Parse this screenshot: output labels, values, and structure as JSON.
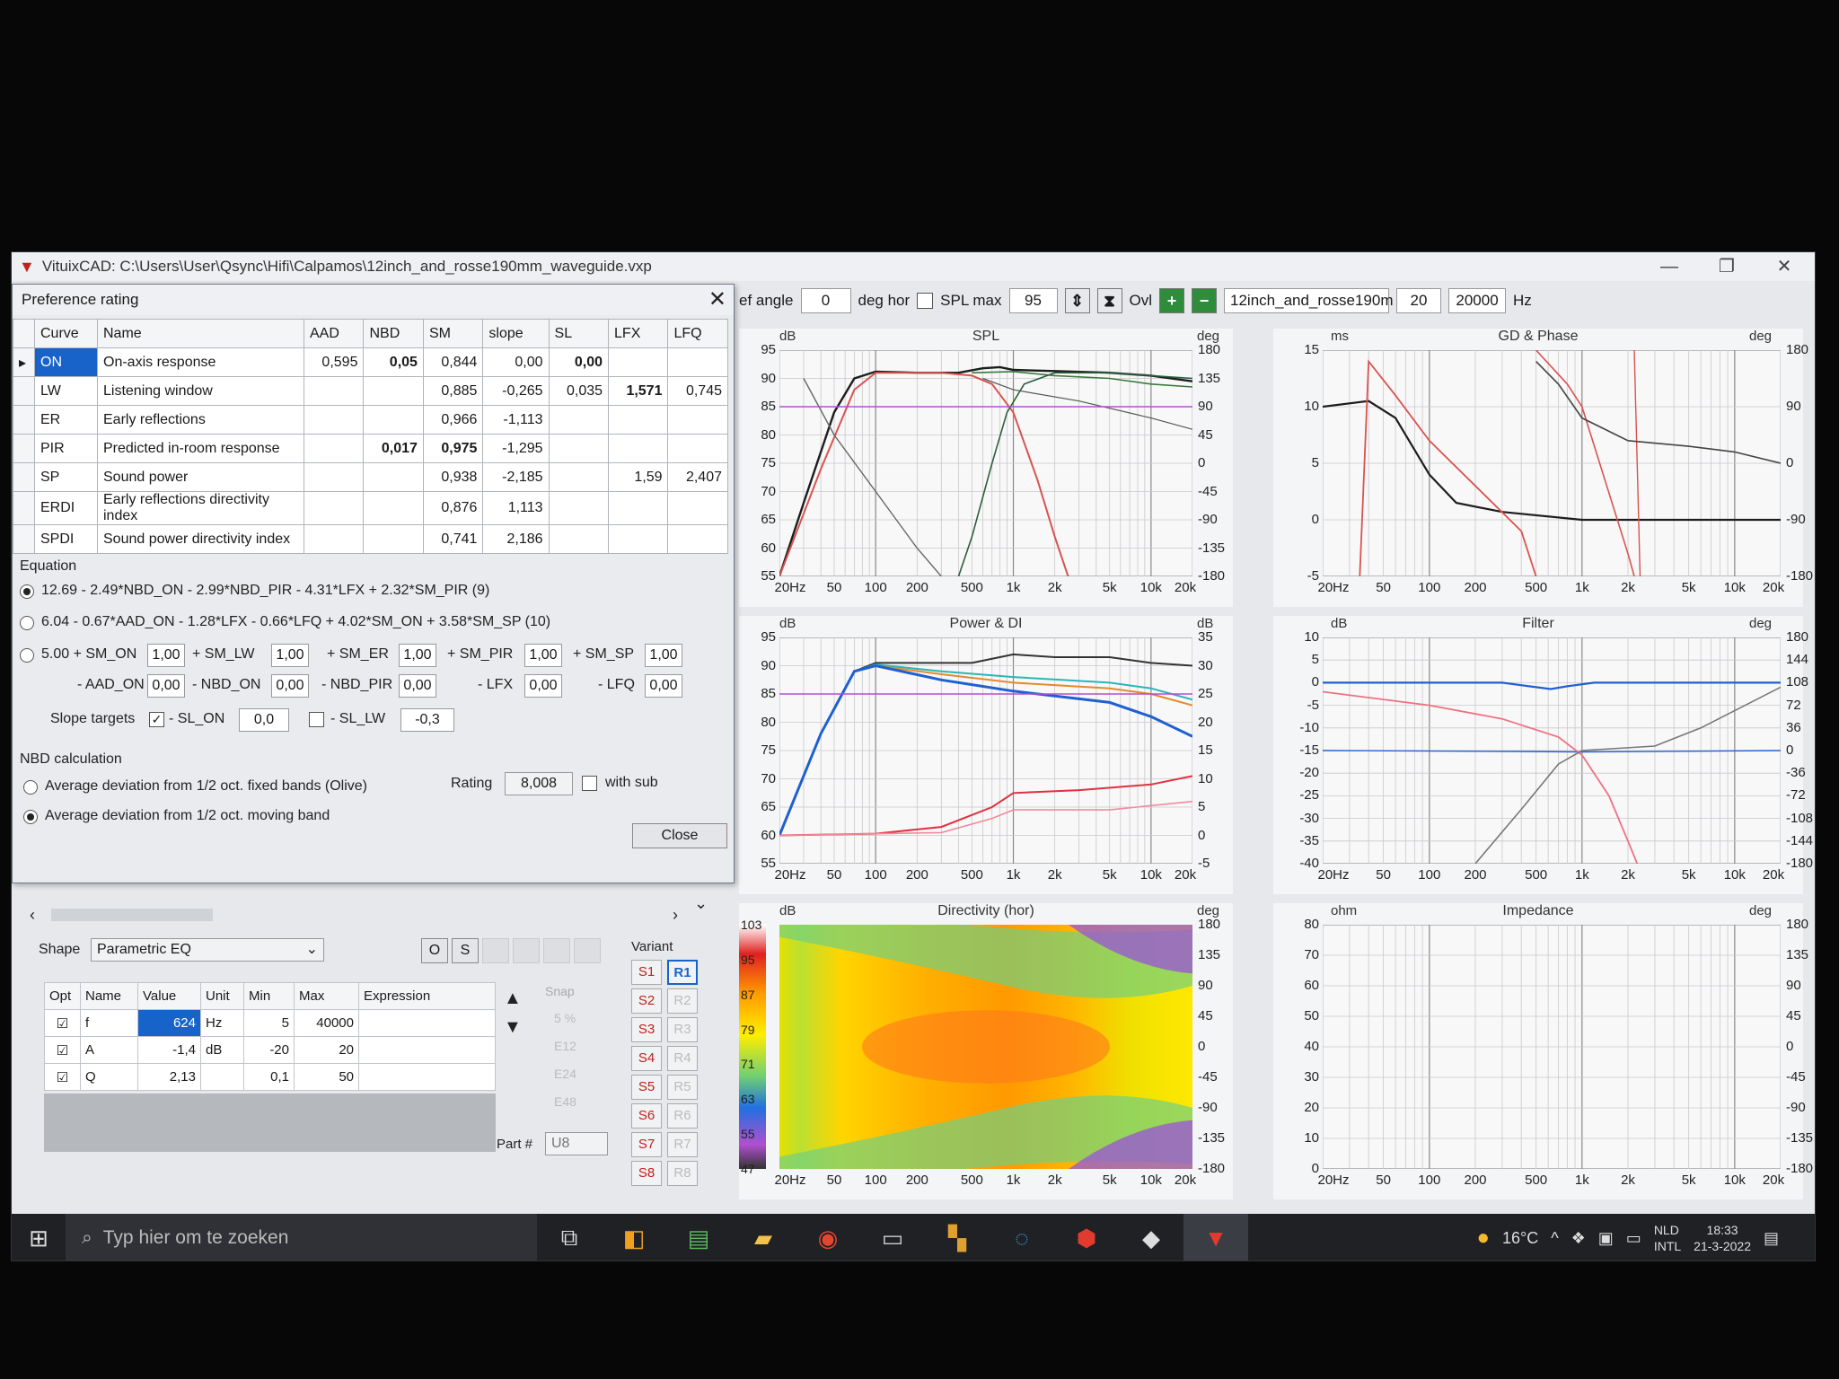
{
  "window": {
    "title": "VituixCAD: C:\\Users\\User\\Qsync\\Hifi\\Calpamos\\12inch_and_rosse190mm_waveguide.vxp"
  },
  "toolbar": {
    "ref_angle_label": "ef angle",
    "ref_angle_value": "0",
    "deg_hor": "deg hor",
    "spl_max_label": "SPL max",
    "spl_max_value": "95",
    "ovl_label": "Ovl",
    "project": "12inch_and_rosse190m",
    "fmin": "20",
    "fmax": "20000",
    "hz": "Hz"
  },
  "dialog": {
    "title": "Preference rating",
    "columns": [
      "Curve",
      "Name",
      "AAD",
      "NBD",
      "SM",
      "slope",
      "SL",
      "LFX",
      "LFQ"
    ],
    "rows": [
      {
        "curve": "ON",
        "name": "On-axis response",
        "aad": "0,595",
        "nbd": "0,05",
        "sm": "0,844",
        "slope": "0,00",
        "sl": "0,00",
        "lfx": "",
        "lfq": ""
      },
      {
        "curve": "LW",
        "name": "Listening window",
        "aad": "",
        "nbd": "",
        "sm": "0,885",
        "slope": "-0,265",
        "sl": "0,035",
        "lfx": "1,571",
        "lfq": "0,745"
      },
      {
        "curve": "ER",
        "name": "Early reflections",
        "aad": "",
        "nbd": "",
        "sm": "0,966",
        "slope": "-1,113",
        "sl": "",
        "lfx": "",
        "lfq": ""
      },
      {
        "curve": "PIR",
        "name": "Predicted in-room response",
        "aad": "",
        "nbd": "0,017",
        "sm": "0,975",
        "slope": "-1,295",
        "sl": "",
        "lfx": "",
        "lfq": ""
      },
      {
        "curve": "SP",
        "name": "Sound power",
        "aad": "",
        "nbd": "",
        "sm": "0,938",
        "slope": "-2,185",
        "sl": "",
        "lfx": "1,59",
        "lfq": "2,407"
      },
      {
        "curve": "ERDI",
        "name": "Early reflections directivity index",
        "aad": "",
        "nbd": "",
        "sm": "0,876",
        "slope": "1,113",
        "sl": "",
        "lfx": "",
        "lfq": ""
      },
      {
        "curve": "SPDI",
        "name": "Sound power directivity index",
        "aad": "",
        "nbd": "",
        "sm": "0,741",
        "slope": "2,186",
        "sl": "",
        "lfx": "",
        "lfq": ""
      }
    ],
    "equation_label": "Equation",
    "eq1": "12.69 - 2.49*NBD_ON - 2.99*NBD_PIR - 4.31*LFX + 2.32*SM_PIR (9)",
    "eq2": "6.04 - 0.67*AAD_ON - 1.28*LFX - 0.66*LFQ + 4.02*SM_ON + 3.58*SM_SP (10)",
    "eq3": {
      "prefix": "5.00 + SM_ON",
      "sm_on": "1,00",
      "sm_lw_lbl": "+ SM_LW",
      "sm_lw": "1,00",
      "sm_er_lbl": "+ SM_ER",
      "sm_er": "1,00",
      "sm_pir_lbl": "+ SM_PIR",
      "sm_pir": "1,00",
      "sm_sp_lbl": "+ SM_SP",
      "sm_sp": "1,00",
      "aad_on_lbl": "- AAD_ON",
      "aad_on": "0,00",
      "nbd_on_lbl": "- NBD_ON",
      "nbd_on": "0,00",
      "nbd_pir_lbl": "- NBD_PIR",
      "nbd_pir": "0,00",
      "lfx_lbl": "- LFX",
      "lfx": "0,00",
      "lfq_lbl": "- LFQ",
      "lfq": "0,00"
    },
    "slope_targets": "Slope targets",
    "sl_on_lbl": "- SL_ON",
    "sl_on": "0,0",
    "sl_lw_lbl": "- SL_LW",
    "sl_lw": "-0,3",
    "nbd_calc": "NBD calculation",
    "nbd_opt1": "Average deviation from 1/2 oct. fixed bands (Olive)",
    "nbd_opt2": "Average deviation from 1/2 oct. moving band",
    "rating_label": "Rating",
    "rating_value": "8,008",
    "with_sub": "with sub",
    "close": "Close"
  },
  "eq_panel": {
    "shape_label": "Shape",
    "shape_value": "Parametric EQ",
    "btn_o": "O",
    "btn_s": "S",
    "columns": [
      "Opt",
      "Name",
      "Value",
      "Unit",
      "Min",
      "Max",
      "Expression"
    ],
    "rows": [
      {
        "name": "f",
        "value": "624",
        "unit": "Hz",
        "min": "5",
        "max": "40000"
      },
      {
        "name": "A",
        "value": "-1,4",
        "unit": "dB",
        "min": "-20",
        "max": "20"
      },
      {
        "name": "Q",
        "value": "2,13",
        "unit": "",
        "min": "0,1",
        "max": "50"
      }
    ],
    "snap": "Snap",
    "snap_opts": [
      "5 %",
      "E12",
      "E24",
      "E48"
    ],
    "variant": "Variant",
    "s_buttons": [
      "S1",
      "S2",
      "S3",
      "S4",
      "S5",
      "S6",
      "S7",
      "S8"
    ],
    "r_buttons": [
      "R1",
      "R2",
      "R3",
      "R4",
      "R5",
      "R6",
      "R7",
      "R8"
    ],
    "part_label": "Part #",
    "part_value": "U8"
  },
  "charts": {
    "spl": {
      "title": "SPL",
      "left_unit": "dB",
      "right_unit": "deg",
      "yl": [
        "95",
        "90",
        "85",
        "80",
        "75",
        "70",
        "65",
        "60",
        "55"
      ],
      "yr": [
        "180",
        "135",
        "90",
        "45",
        "0",
        "-45",
        "-90",
        "-135",
        "-180"
      ]
    },
    "gd": {
      "title": "GD & Phase",
      "left_unit": "ms",
      "right_unit": "deg",
      "yl": [
        "15",
        "10",
        "5",
        "0",
        "-5"
      ],
      "yr": [
        "180",
        "90",
        "0",
        "-90",
        "-180"
      ]
    },
    "power": {
      "title": "Power & DI",
      "left_unit": "dB",
      "right_unit": "dB",
      "yl": [
        "95",
        "90",
        "85",
        "80",
        "75",
        "70",
        "65",
        "60",
        "55"
      ],
      "yr": [
        "35",
        "30",
        "25",
        "20",
        "15",
        "10",
        "5",
        "0",
        "-5"
      ]
    },
    "filter": {
      "title": "Filter",
      "left_unit": "dB",
      "right_unit": "deg",
      "yl": [
        "10",
        "5",
        "0",
        "-5",
        "-10",
        "-15",
        "-20",
        "-25",
        "-30",
        "-35",
        "-40"
      ],
      "yr": [
        "180",
        "144",
        "108",
        "72",
        "36",
        "0",
        "-36",
        "-72",
        "-108",
        "-144",
        "-180"
      ]
    },
    "dir": {
      "title": "Directivity (hor)",
      "right_unit": "deg",
      "left_unit": "dB",
      "scale": [
        "103",
        "95",
        "87",
        "79",
        "71",
        "63",
        "55",
        "47"
      ],
      "yr": [
        "180",
        "135",
        "90",
        "45",
        "0",
        "-45",
        "-90",
        "-135",
        "-180"
      ]
    },
    "imp": {
      "title": "Impedance",
      "left_unit": "ohm",
      "right_unit": "deg",
      "yl": [
        "80",
        "70",
        "60",
        "50",
        "40",
        "30",
        "20",
        "10",
        "0"
      ],
      "yr": [
        "180",
        "135",
        "90",
        "45",
        "0",
        "-45",
        "-90",
        "-135",
        "-180"
      ]
    },
    "xticks": [
      "20Hz",
      "50",
      "100",
      "200",
      "500",
      "1k",
      "2k",
      "5k",
      "10k",
      "20k"
    ],
    "xticks_short": [
      "20Hz",
      "50",
      "100",
      "200",
      "500",
      "1k",
      "2k",
      "5k",
      "10k",
      "20k"
    ]
  },
  "taskbar": {
    "search_placeholder": "Typ hier om te zoeken",
    "temp": "16°C",
    "lang1": "NLD",
    "lang2": "INTL",
    "time": "18:33",
    "date": "21-3-2022"
  }
}
